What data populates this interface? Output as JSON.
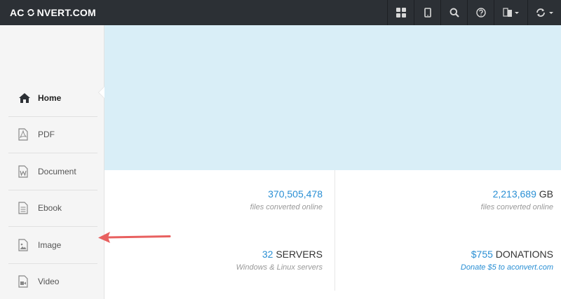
{
  "header": {
    "brand_left": "AC",
    "brand_right": "NVERT.COM",
    "icons": [
      "grid-icon",
      "tablet-icon",
      "search-icon",
      "help-icon",
      "language-icon",
      "refresh-icon"
    ]
  },
  "sidebar": {
    "items": [
      {
        "label": "Home",
        "icon": "home-icon",
        "active": true
      },
      {
        "label": "PDF",
        "icon": "pdf-icon"
      },
      {
        "label": "Document",
        "icon": "document-icon"
      },
      {
        "label": "Ebook",
        "icon": "ebook-icon"
      },
      {
        "label": "Image",
        "icon": "image-icon"
      },
      {
        "label": "Video",
        "icon": "video-icon"
      }
    ]
  },
  "stats": {
    "files": {
      "value": "370,505,478",
      "sub": "files converted online"
    },
    "size": {
      "value": "2,213,689",
      "unit": "GB",
      "sub": "files converted online"
    },
    "servers": {
      "value": "32",
      "unit": "SERVERS",
      "sub": "Windows & Linux servers"
    },
    "donations": {
      "value": "$755",
      "unit": "DONATIONS",
      "sub": "Donate $5 to aconvert.com"
    }
  },
  "colors": {
    "topbar": "#2c3035",
    "accent": "#2a8fd4",
    "banner": "#d9eef7",
    "annotation_arrow": "#e8605f"
  }
}
